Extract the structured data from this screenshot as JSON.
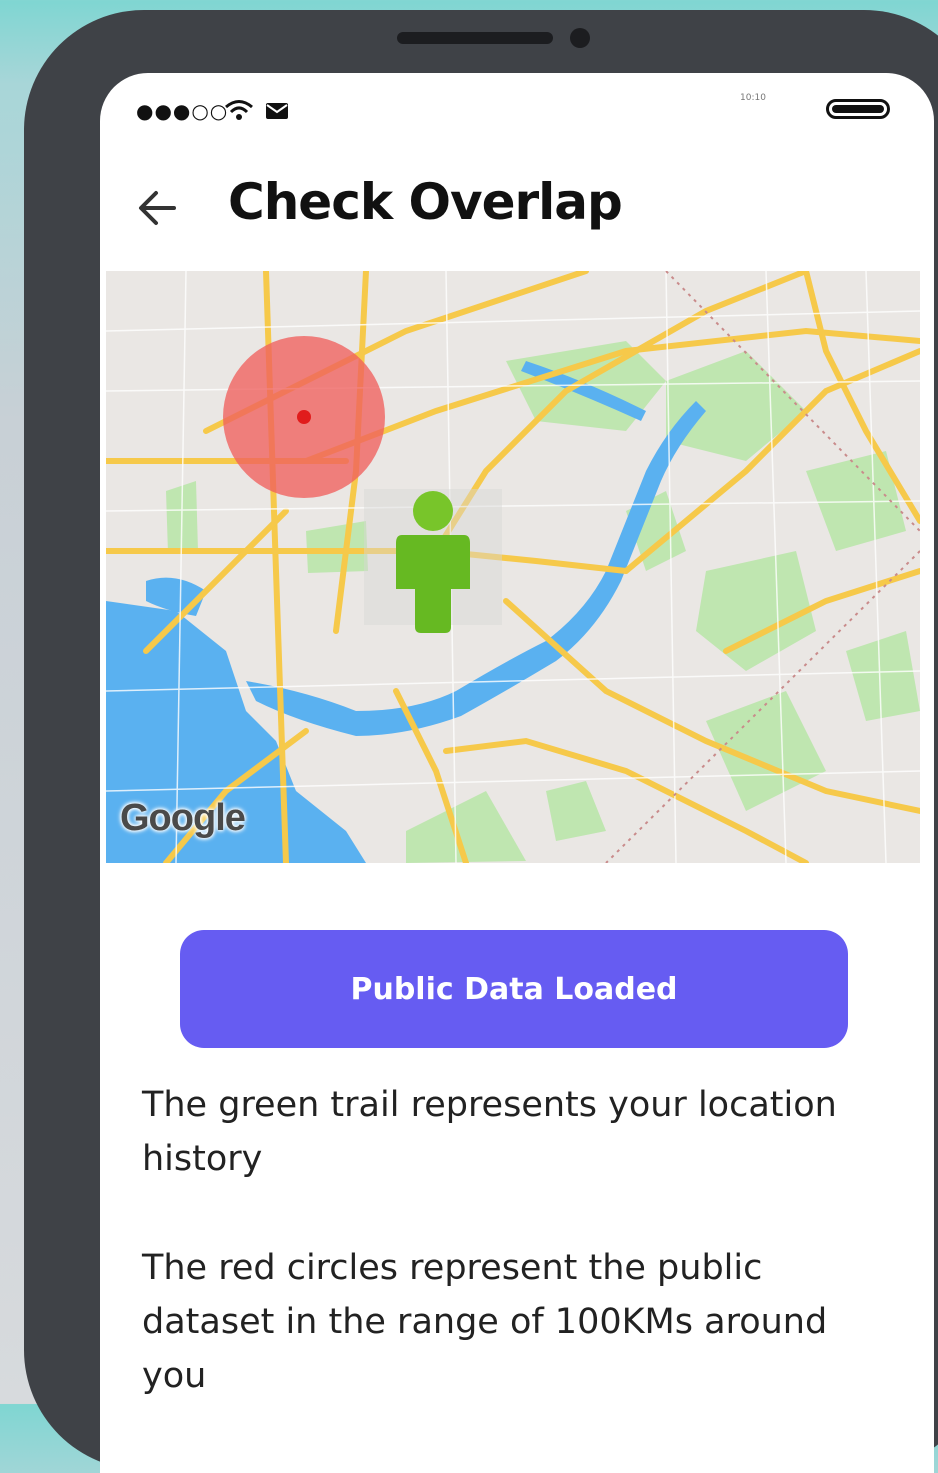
{
  "status_bar": {
    "signal": "●●●○○",
    "time": "10:10"
  },
  "header": {
    "title": "Check Overlap",
    "back_icon": "arrow-left-icon"
  },
  "map": {
    "attribution": "Google",
    "markers": [
      {
        "kind": "public-dataset-circle",
        "color": "#f0605e"
      },
      {
        "kind": "user-location-person",
        "color": "#6bbf1f"
      }
    ]
  },
  "button": {
    "label": "Public Data Loaded",
    "color": "#665cf2"
  },
  "descriptions": [
    "The green trail represents your location history",
    "The red circles represent the public dataset in the range of 100KMs around you"
  ]
}
